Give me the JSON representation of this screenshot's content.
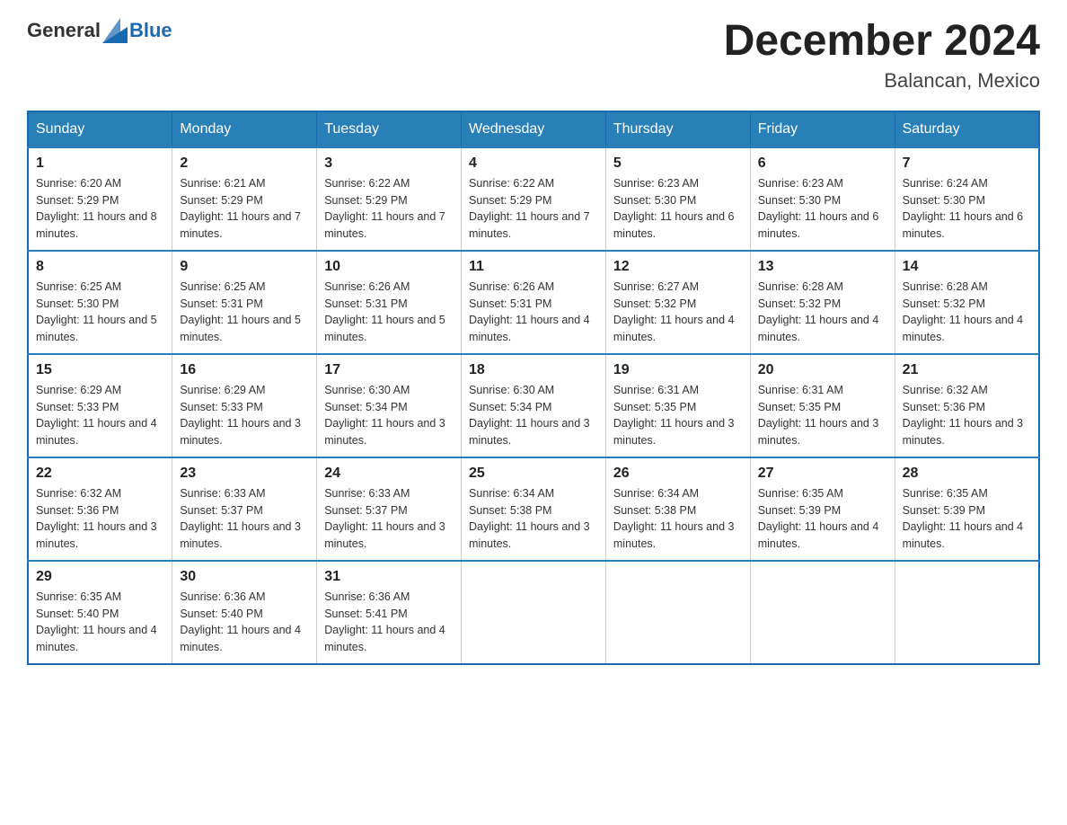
{
  "header": {
    "logo_general": "General",
    "logo_blue": "Blue",
    "month_title": "December 2024",
    "subtitle": "Balancan, Mexico"
  },
  "days_of_week": [
    "Sunday",
    "Monday",
    "Tuesday",
    "Wednesday",
    "Thursday",
    "Friday",
    "Saturday"
  ],
  "weeks": [
    [
      {
        "day": "1",
        "sunrise": "6:20 AM",
        "sunset": "5:29 PM",
        "daylight": "11 hours and 8 minutes."
      },
      {
        "day": "2",
        "sunrise": "6:21 AM",
        "sunset": "5:29 PM",
        "daylight": "11 hours and 7 minutes."
      },
      {
        "day": "3",
        "sunrise": "6:22 AM",
        "sunset": "5:29 PM",
        "daylight": "11 hours and 7 minutes."
      },
      {
        "day": "4",
        "sunrise": "6:22 AM",
        "sunset": "5:29 PM",
        "daylight": "11 hours and 7 minutes."
      },
      {
        "day": "5",
        "sunrise": "6:23 AM",
        "sunset": "5:30 PM",
        "daylight": "11 hours and 6 minutes."
      },
      {
        "day": "6",
        "sunrise": "6:23 AM",
        "sunset": "5:30 PM",
        "daylight": "11 hours and 6 minutes."
      },
      {
        "day": "7",
        "sunrise": "6:24 AM",
        "sunset": "5:30 PM",
        "daylight": "11 hours and 6 minutes."
      }
    ],
    [
      {
        "day": "8",
        "sunrise": "6:25 AM",
        "sunset": "5:30 PM",
        "daylight": "11 hours and 5 minutes."
      },
      {
        "day": "9",
        "sunrise": "6:25 AM",
        "sunset": "5:31 PM",
        "daylight": "11 hours and 5 minutes."
      },
      {
        "day": "10",
        "sunrise": "6:26 AM",
        "sunset": "5:31 PM",
        "daylight": "11 hours and 5 minutes."
      },
      {
        "day": "11",
        "sunrise": "6:26 AM",
        "sunset": "5:31 PM",
        "daylight": "11 hours and 4 minutes."
      },
      {
        "day": "12",
        "sunrise": "6:27 AM",
        "sunset": "5:32 PM",
        "daylight": "11 hours and 4 minutes."
      },
      {
        "day": "13",
        "sunrise": "6:28 AM",
        "sunset": "5:32 PM",
        "daylight": "11 hours and 4 minutes."
      },
      {
        "day": "14",
        "sunrise": "6:28 AM",
        "sunset": "5:32 PM",
        "daylight": "11 hours and 4 minutes."
      }
    ],
    [
      {
        "day": "15",
        "sunrise": "6:29 AM",
        "sunset": "5:33 PM",
        "daylight": "11 hours and 4 minutes."
      },
      {
        "day": "16",
        "sunrise": "6:29 AM",
        "sunset": "5:33 PM",
        "daylight": "11 hours and 3 minutes."
      },
      {
        "day": "17",
        "sunrise": "6:30 AM",
        "sunset": "5:34 PM",
        "daylight": "11 hours and 3 minutes."
      },
      {
        "day": "18",
        "sunrise": "6:30 AM",
        "sunset": "5:34 PM",
        "daylight": "11 hours and 3 minutes."
      },
      {
        "day": "19",
        "sunrise": "6:31 AM",
        "sunset": "5:35 PM",
        "daylight": "11 hours and 3 minutes."
      },
      {
        "day": "20",
        "sunrise": "6:31 AM",
        "sunset": "5:35 PM",
        "daylight": "11 hours and 3 minutes."
      },
      {
        "day": "21",
        "sunrise": "6:32 AM",
        "sunset": "5:36 PM",
        "daylight": "11 hours and 3 minutes."
      }
    ],
    [
      {
        "day": "22",
        "sunrise": "6:32 AM",
        "sunset": "5:36 PM",
        "daylight": "11 hours and 3 minutes."
      },
      {
        "day": "23",
        "sunrise": "6:33 AM",
        "sunset": "5:37 PM",
        "daylight": "11 hours and 3 minutes."
      },
      {
        "day": "24",
        "sunrise": "6:33 AM",
        "sunset": "5:37 PM",
        "daylight": "11 hours and 3 minutes."
      },
      {
        "day": "25",
        "sunrise": "6:34 AM",
        "sunset": "5:38 PM",
        "daylight": "11 hours and 3 minutes."
      },
      {
        "day": "26",
        "sunrise": "6:34 AM",
        "sunset": "5:38 PM",
        "daylight": "11 hours and 3 minutes."
      },
      {
        "day": "27",
        "sunrise": "6:35 AM",
        "sunset": "5:39 PM",
        "daylight": "11 hours and 4 minutes."
      },
      {
        "day": "28",
        "sunrise": "6:35 AM",
        "sunset": "5:39 PM",
        "daylight": "11 hours and 4 minutes."
      }
    ],
    [
      {
        "day": "29",
        "sunrise": "6:35 AM",
        "sunset": "5:40 PM",
        "daylight": "11 hours and 4 minutes."
      },
      {
        "day": "30",
        "sunrise": "6:36 AM",
        "sunset": "5:40 PM",
        "daylight": "11 hours and 4 minutes."
      },
      {
        "day": "31",
        "sunrise": "6:36 AM",
        "sunset": "5:41 PM",
        "daylight": "11 hours and 4 minutes."
      },
      null,
      null,
      null,
      null
    ]
  ],
  "labels": {
    "sunrise": "Sunrise:",
    "sunset": "Sunset:",
    "daylight": "Daylight:"
  }
}
